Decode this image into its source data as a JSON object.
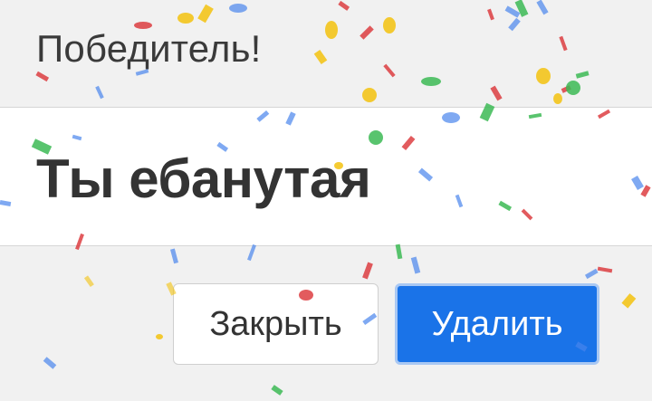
{
  "dialog": {
    "title": "Победитель!",
    "result": "Ты ебанутая"
  },
  "buttons": {
    "close_label": "Закрыть",
    "delete_label": "Удалить"
  },
  "colors": {
    "primary": "#1a73e8",
    "confetti": [
      "#f4c20d",
      "#db3236",
      "#3cba54",
      "#4885ed"
    ]
  }
}
